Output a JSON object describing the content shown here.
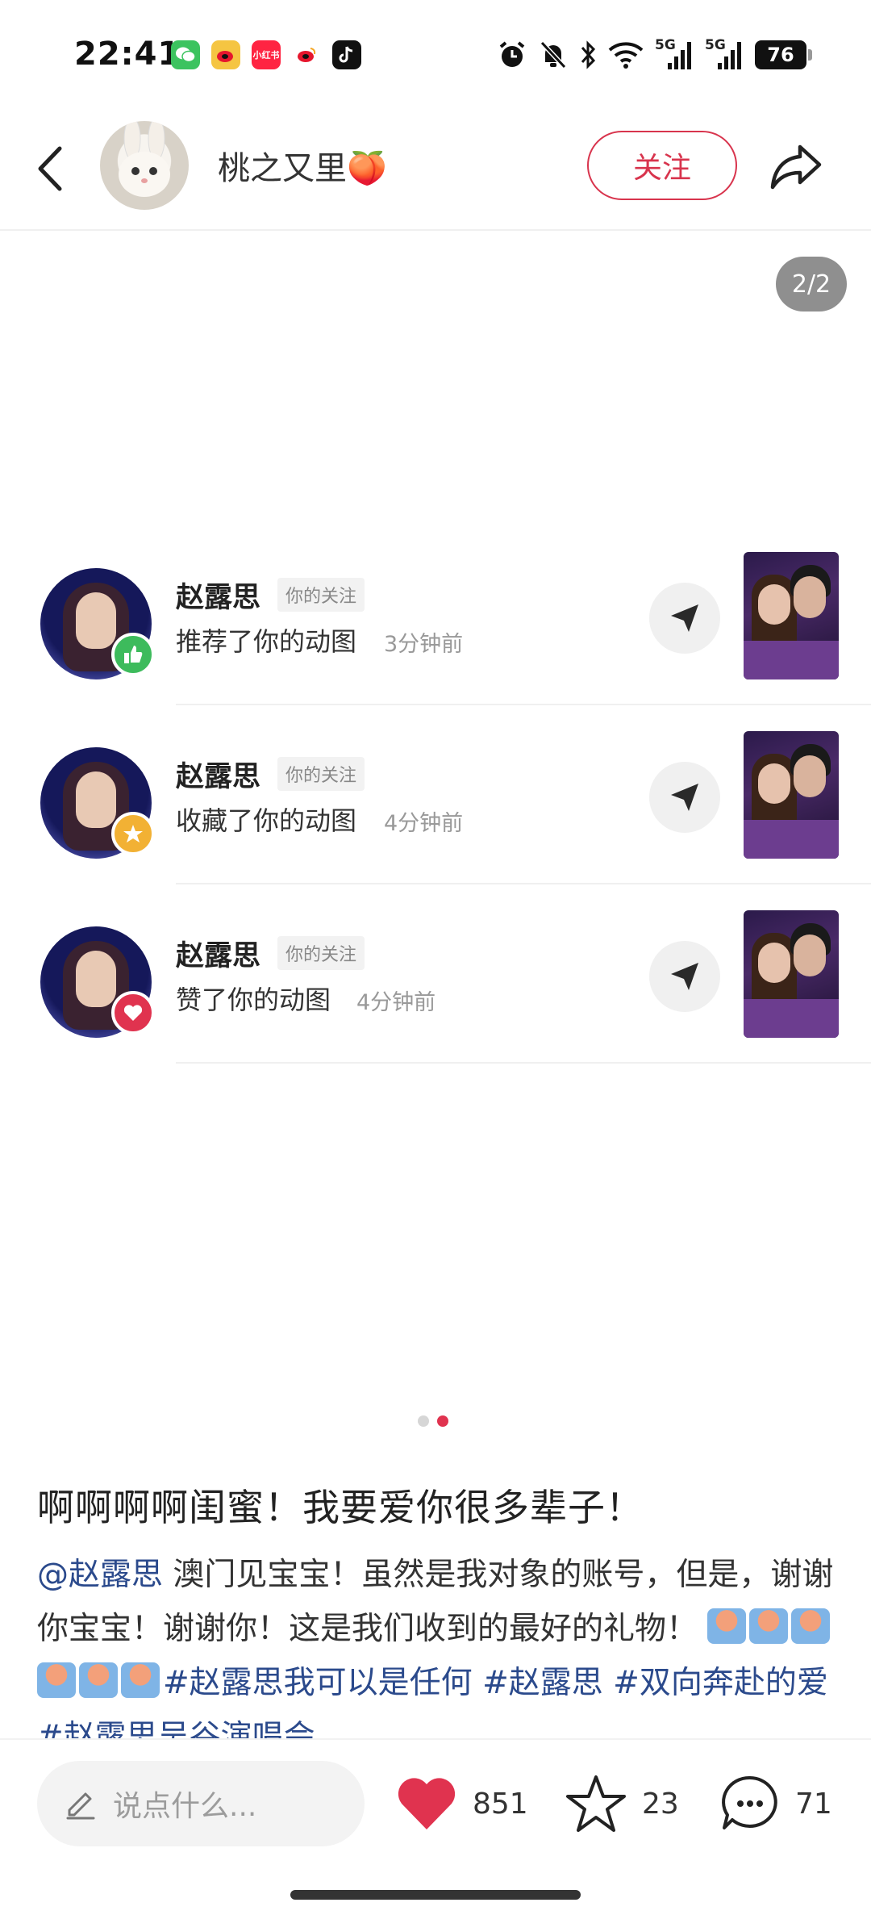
{
  "status_bar": {
    "time": "22:41",
    "app_icons": [
      "wechat-icon",
      "weibo-icon",
      "xiaohongshu-icon",
      "weibo-icon",
      "tiktok-icon"
    ],
    "xiaohongshu_label": "小红书",
    "signal_5g_1": "5G",
    "signal_5g_2": "5G",
    "battery": "76"
  },
  "header": {
    "username": "桃之又里🍑",
    "follow_label": "关注"
  },
  "page_counter": "2/2",
  "notifications": [
    {
      "name": "赵露思",
      "tag": "你的关注",
      "action": "推荐了你的动图",
      "time": "3分钟前",
      "badge": "like"
    },
    {
      "name": "赵露思",
      "tag": "你的关注",
      "action": "收藏了你的动图",
      "time": "4分钟前",
      "badge": "star"
    },
    {
      "name": "赵露思",
      "tag": "你的关注",
      "action": "赞了你的动图",
      "time": "4分钟前",
      "badge": "heart"
    }
  ],
  "carousel": {
    "total": 2,
    "current": 2
  },
  "post": {
    "title": "啊啊啊啊闺蜜！我要爱你很多辈子！",
    "mention": "@赵露思",
    "body_text": " 澳门见宝宝！虽然是我对象的账号，但是，谢谢你宝宝！谢谢你！这是我们收到的最好的礼物！",
    "hashtags": "#赵露思我可以是任何 #赵露思 #双向奔赴的爱 #赵露思吴谷演唱会"
  },
  "bottom_bar": {
    "comment_placeholder": "说点什么...",
    "likes": "851",
    "stars": "23",
    "comments": "71"
  },
  "colors": {
    "accent": "#d8344d",
    "like_red": "#e0334f",
    "link_blue": "#2b4a8c"
  }
}
